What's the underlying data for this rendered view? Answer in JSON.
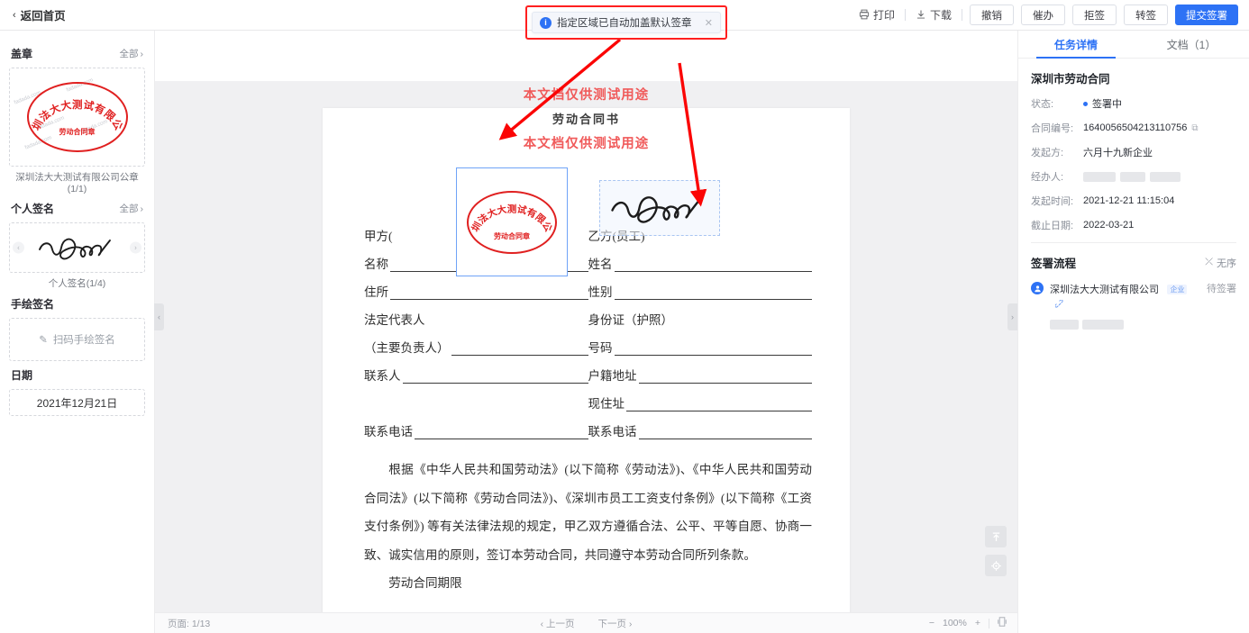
{
  "topbar": {
    "back_label": "返回首页",
    "print_label": "打印",
    "download_label": "下载",
    "buttons": [
      {
        "label": "撤销"
      },
      {
        "label": "催办"
      },
      {
        "label": "拒签"
      },
      {
        "label": "转签"
      }
    ],
    "primary_label": "提交签署"
  },
  "toast": {
    "message": "指定区域已自动加盖默认签章",
    "close": "✕",
    "icon": "info-icon",
    "highlight_color": "#ff1f1f"
  },
  "sidebar": {
    "stamp": {
      "title": "盖章",
      "all_label": "全部",
      "caption": "深圳法大大测试有限公司公章(1/1)",
      "stamp_arc_text": "深圳法大大测试有限公司",
      "stamp_sub_text": "劳动合同章",
      "watermark": "fadada.com"
    },
    "personal_sign": {
      "title": "个人签名",
      "all_label": "全部",
      "caption": "个人签名(1/4)"
    },
    "hand_sign": {
      "title": "手绘签名",
      "action_label": "扫码手绘签名"
    },
    "date": {
      "title": "日期",
      "value": "2021年12月21日"
    }
  },
  "document": {
    "watermark_text": "本文档仅供测试用途",
    "title": "劳动合同书",
    "party_a_label": "甲方(",
    "party_a_label_full": "甲方（用人单位）",
    "party_b_label": "乙方(员工)",
    "fields_left": [
      {
        "label": "名称",
        "line": true
      },
      {
        "label": "住所",
        "line": true
      },
      {
        "label": "法定代表人",
        "line": false
      },
      {
        "label": "（主要负责人）",
        "line": true
      },
      {
        "label": "联系人",
        "line": true
      },
      {
        "label": "",
        "line": false
      },
      {
        "label": "联系电话",
        "line": true
      }
    ],
    "fields_right": [
      {
        "label": "姓名",
        "line": true
      },
      {
        "label": "性别",
        "line": true
      },
      {
        "label": "身份证（护照）",
        "line": false
      },
      {
        "label": "号码",
        "line": true
      },
      {
        "label": "户籍地址",
        "line": true
      },
      {
        "label": "现住址",
        "line": true
      },
      {
        "label": "联系电话",
        "line": true
      }
    ],
    "paragraph": "根据《中华人民共和国劳动法》(以下简称《劳动法》)、《中华人民共和国劳动合同法》(以下简称《劳动合同法》)、《深圳市员工工资支付条例》(以下简称《工资支付条例》) 等有关法律法规的规定，甲乙双方遵循合法、公平、平等自愿、协商一致、诚实信用的原则，签订本劳动合同，共同遵守本劳动合同所列条款。",
    "next_heading": "劳动合同期限"
  },
  "bottombar": {
    "page_label": "页面: 1/13",
    "prev_label": "上一页",
    "next_label": "下一页",
    "zoom_minus": "−",
    "zoom_value": "100%",
    "zoom_plus": "+"
  },
  "rightpanel": {
    "tabs": [
      {
        "label": "任务详情",
        "active": true
      },
      {
        "label": "文档（1）",
        "active": false
      }
    ],
    "doc_title": "深圳市劳动合同",
    "details": [
      {
        "key": "状态:",
        "value": "签署中",
        "type": "status"
      },
      {
        "key": "合同编号:",
        "value": "1640056504213110756",
        "type": "copy"
      },
      {
        "key": "发起方:",
        "value": "六月十九新企业",
        "type": "text"
      },
      {
        "key": "经办人:",
        "value": "",
        "type": "redacted"
      },
      {
        "key": "发起时间:",
        "value": "2021-12-21 11:15:04",
        "type": "text"
      },
      {
        "key": "截止日期:",
        "value": "2022-03-21",
        "type": "text"
      }
    ],
    "flow": {
      "title": "签署流程",
      "mode_label": "无序",
      "signers": [
        {
          "name": "深圳法大大测试有限公司",
          "badge": "企业",
          "status": "待签署"
        }
      ]
    }
  },
  "icons": {
    "back_chevron": "‹",
    "print": "print-icon",
    "download": "download-icon",
    "all_chevron": "›",
    "pen": "✎",
    "copy": "⧉",
    "link": "🔗",
    "shuffle": "⤫",
    "scroll_top": "scroll-top-icon",
    "locate": "locate-icon",
    "prev_chevron": "‹",
    "next_chevron": "›",
    "fit_page": "fit-page-icon",
    "avatar": "user-icon"
  },
  "colors": {
    "accent": "#2d72f5",
    "stamp_red": "#e02020",
    "annotation_red": "#fb0505",
    "watermark_red": "#f05a5a"
  }
}
